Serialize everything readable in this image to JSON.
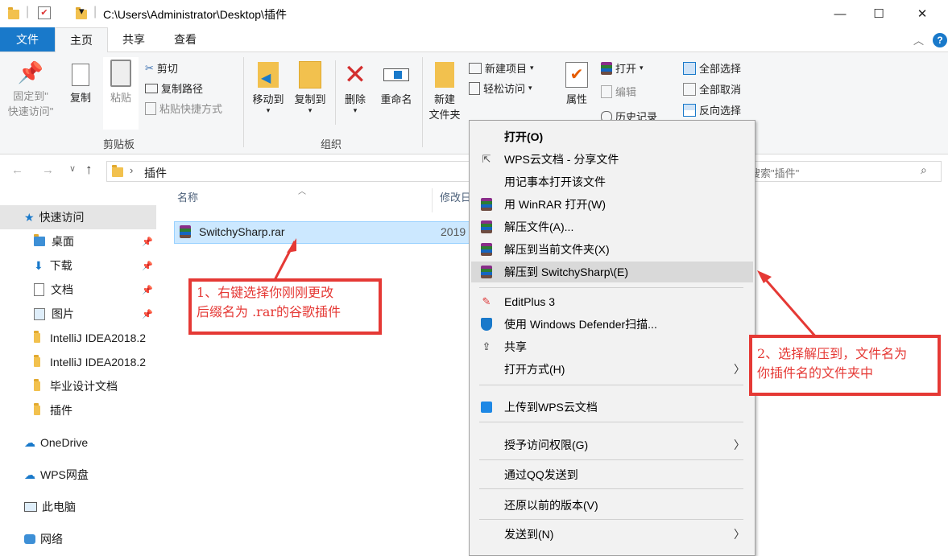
{
  "window": {
    "path": "C:\\Users\\Administrator\\Desktop\\插件",
    "minimize": "—",
    "maximize": "☐",
    "close": "✕"
  },
  "tabs": [
    "文件",
    "主页",
    "共享",
    "查看"
  ],
  "ribbon": {
    "pin_label_1": "固定到\"",
    "pin_label_2": "快速访问\"",
    "copy": "复制",
    "paste": "粘贴",
    "cut": "剪切",
    "copy_path": "复制路径",
    "paste_shortcut": "粘贴快捷方式",
    "clipboard_group": "剪贴板",
    "move_to": "移动到",
    "copy_to": "复制到",
    "delete": "删除",
    "rename": "重命名",
    "organize_group": "组织",
    "new_folder_1": "新建",
    "new_folder_2": "文件夹",
    "new_item": "新建项目",
    "easy_access": "轻松访问",
    "properties": "属性",
    "open": "打开",
    "edit": "编辑",
    "history": "历史记录",
    "select_all": "全部选择",
    "select_none": "全部取消",
    "invert_selection": "反向选择"
  },
  "address": {
    "crumb": "插件",
    "search_placeholder": "搜索\"插件\""
  },
  "nav": {
    "quick_access": "快速访问",
    "items": [
      "桌面",
      "下载",
      "文档",
      "图片",
      "IntelliJ IDEA2018.2",
      "IntelliJ IDEA2018.2",
      "毕业设计文档",
      "插件"
    ],
    "onedrive": "OneDrive",
    "wps": "WPS网盘",
    "this_pc": "此电脑",
    "network": "网络"
  },
  "files": {
    "col_name": "名称",
    "col_modified": "修改日",
    "rows": [
      {
        "name": "SwitchySharp.rar",
        "modified": "2019"
      }
    ]
  },
  "context_menu": {
    "items": [
      "打开(O)",
      "WPS云文档 - 分享文件",
      "用记事本打开该文件",
      "用 WinRAR 打开(W)",
      "解压文件(A)...",
      "解压到当前文件夹(X)",
      "解压到 SwitchySharp\\(E)",
      "EditPlus 3",
      "使用 Windows Defender扫描...",
      "共享",
      "打开方式(H)",
      "上传到WPS云文档",
      "授予访问权限(G)",
      "通过QQ发送到",
      "还原以前的版本(V)",
      "发送到(N)"
    ]
  },
  "annotations": {
    "note1_line1": "1、右键选择你刚刚更改",
    "note1_line2": "后缀名为 .rar的谷歌插件",
    "note2_line1": "2、选择解压到，文件名为",
    "note2_line2": "你插件名的文件夹中"
  },
  "colors": {
    "accent": "#1979ca",
    "annotation": "#e53935",
    "selection": "#cce8ff"
  }
}
